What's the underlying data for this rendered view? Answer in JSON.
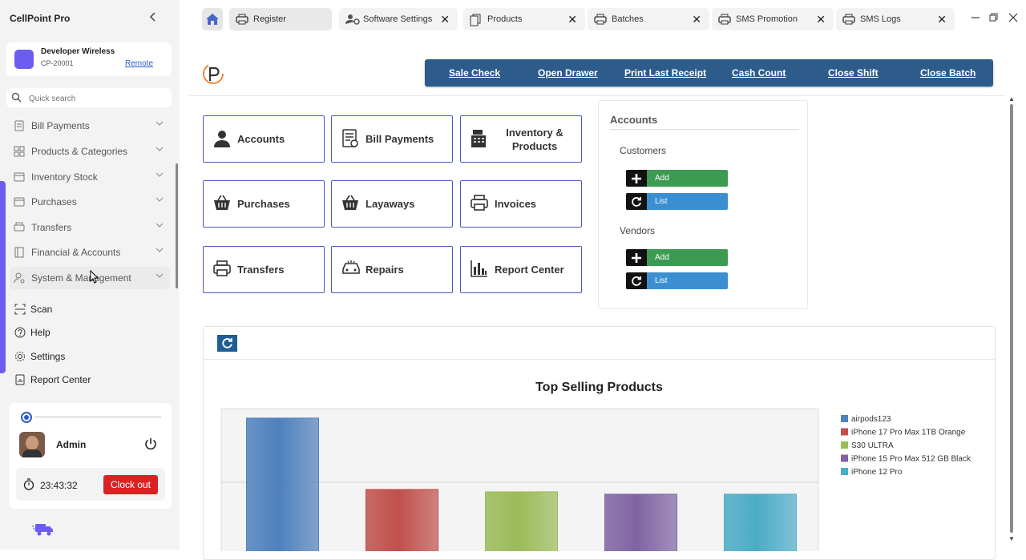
{
  "sidebar": {
    "app_title": "CellPoint Pro",
    "store": {
      "name": "Developer Wireless",
      "code": "CP-20001",
      "mode": "Remote"
    },
    "search_placeholder": "Quick search",
    "nav": [
      {
        "label": "Bill Payments",
        "icon": "bill-icon"
      },
      {
        "label": "Products & Categories",
        "icon": "grid-icon"
      },
      {
        "label": "Inventory Stock",
        "icon": "box-icon"
      },
      {
        "label": "Purchases",
        "icon": "cart-icon"
      },
      {
        "label": "Transfers",
        "icon": "printer-icon"
      },
      {
        "label": "Financial & Accounts",
        "icon": "ledger-icon"
      },
      {
        "label": "System & Management",
        "icon": "user-gear-icon"
      }
    ],
    "links": [
      {
        "label": "Scan",
        "icon": "scan-icon"
      },
      {
        "label": "Help",
        "icon": "help-icon"
      },
      {
        "label": "Settings",
        "icon": "gear-icon"
      },
      {
        "label": "Report Center",
        "icon": "report-icon"
      }
    ],
    "user": {
      "name": "Admin",
      "clock": "23:43:32",
      "clock_out": "Clock out"
    }
  },
  "tabs": [
    {
      "label": "Register",
      "icon": "printer-icon",
      "closable": false,
      "active": true
    },
    {
      "label": "Software Settings",
      "icon": "settings-user-icon",
      "closable": true
    },
    {
      "label": "Products",
      "icon": "copy-icon",
      "closable": true
    },
    {
      "label": "Batches",
      "icon": "printer-icon",
      "closable": true
    },
    {
      "label": "SMS Promotion",
      "icon": "printer-icon",
      "closable": true
    },
    {
      "label": "SMS Logs",
      "icon": "printer-icon",
      "closable": true
    }
  ],
  "actions": [
    "Sale Check",
    "Open Drawer",
    "Print Last Receipt",
    "Cash Count",
    "Close Shift",
    "Close Batch"
  ],
  "tiles": [
    {
      "label": "Accounts",
      "icon": "person-icon"
    },
    {
      "label": "Bill Payments",
      "icon": "bill-icon"
    },
    {
      "label": "Inventory & Products",
      "icon": "cash-register-icon"
    },
    {
      "label": "Purchases",
      "icon": "basket-icon"
    },
    {
      "label": "Layaways",
      "icon": "basket-icon"
    },
    {
      "label": "Invoices",
      "icon": "printer-icon"
    },
    {
      "label": "Transfers",
      "icon": "printer-icon"
    },
    {
      "label": "Repairs",
      "icon": "car-icon"
    },
    {
      "label": "Report Center",
      "icon": "bar-chart-icon"
    }
  ],
  "accounts_panel": {
    "title": "Accounts",
    "customers": {
      "label": "Customers",
      "add": "Add",
      "list": "List"
    },
    "vendors": {
      "label": "Vendors",
      "add": "Add",
      "list": "List"
    }
  },
  "chart_data": {
    "type": "bar",
    "title": "Top Selling Products",
    "categories": [
      "airpods123",
      "iPhone 17 Pro Max 1TB Orange",
      "S30 ULTRA",
      "iPhone 15 Pro Max 512 GB Black",
      "iPhone 12 Pro"
    ],
    "values": [
      6,
      3,
      2.9,
      2.8,
      2.8
    ],
    "colors": [
      "#4f81bd",
      "#c0504d",
      "#9bbb59",
      "#8064a2",
      "#4bacc6"
    ],
    "legend": "right",
    "grid": true
  }
}
